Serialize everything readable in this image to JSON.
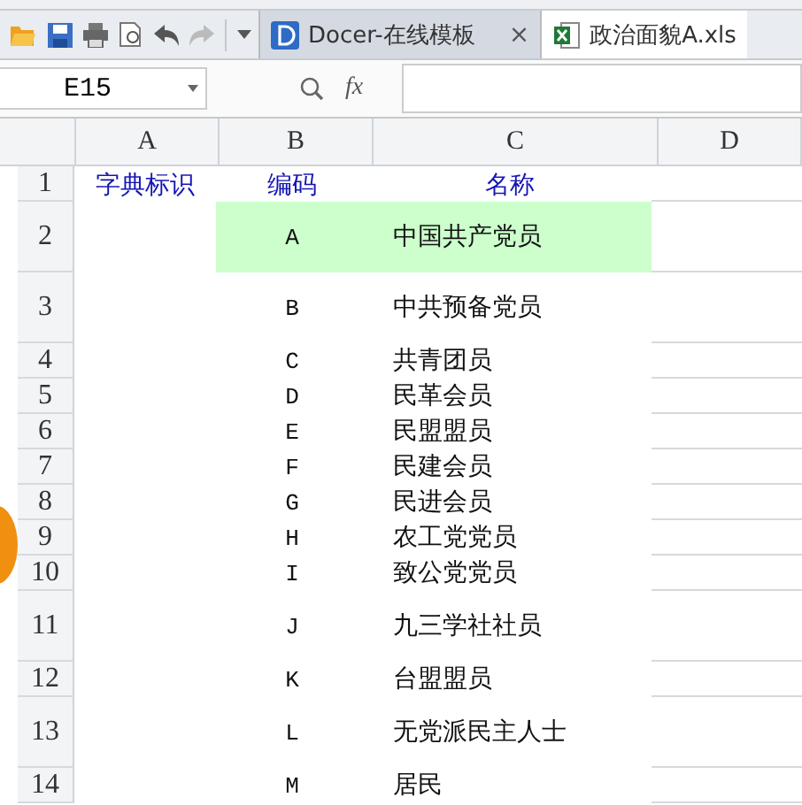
{
  "tabs": [
    {
      "label": "Docer-在线模板",
      "close": "×",
      "selected": false
    },
    {
      "label": "政治面貌A.xls",
      "selected": true
    }
  ],
  "name_box": {
    "value": "E15"
  },
  "formula_bar": {
    "fx": "fx"
  },
  "table": {
    "columns": [
      "A",
      "B",
      "C",
      "D"
    ],
    "rows": [
      {
        "number": "1",
        "cells": [
          "字典标识",
          "编码",
          "名称"
        ],
        "kind": "header",
        "highlighted": false
      },
      {
        "number": "2",
        "cells": [
          "",
          "A",
          "中国共产党员"
        ],
        "kind": "data",
        "highlighted": true
      },
      {
        "number": "3",
        "cells": [
          "",
          "B",
          "中共预备党员"
        ],
        "kind": "data",
        "highlighted": false
      },
      {
        "number": "4",
        "cells": [
          "",
          "C",
          "共青团员"
        ],
        "kind": "data",
        "highlighted": false
      },
      {
        "number": "5",
        "cells": [
          "",
          "D",
          "民革会员"
        ],
        "kind": "data",
        "highlighted": false
      },
      {
        "number": "6",
        "cells": [
          "",
          "E",
          "民盟盟员"
        ],
        "kind": "data",
        "highlighted": false
      },
      {
        "number": "7",
        "cells": [
          "",
          "F",
          "民建会员"
        ],
        "kind": "data",
        "highlighted": false
      },
      {
        "number": "8",
        "cells": [
          "",
          "G",
          "民进会员"
        ],
        "kind": "data",
        "highlighted": false
      },
      {
        "number": "9",
        "cells": [
          "",
          "H",
          "农工党党员"
        ],
        "kind": "data",
        "highlighted": false
      },
      {
        "number": "10",
        "cells": [
          "",
          "I",
          "致公党党员"
        ],
        "kind": "data",
        "highlighted": false
      },
      {
        "number": "11",
        "cells": [
          "",
          "J",
          "九三学社社员"
        ],
        "kind": "data",
        "highlighted": false
      },
      {
        "number": "12",
        "cells": [
          "",
          "K",
          "台盟盟员"
        ],
        "kind": "data",
        "highlighted": false
      },
      {
        "number": "13",
        "cells": [
          "",
          "L",
          "无党派民主人士"
        ],
        "kind": "data",
        "highlighted": false
      },
      {
        "number": "14",
        "cells": [
          "",
          "M",
          "居民"
        ],
        "kind": "data",
        "highlighted": false
      }
    ]
  }
}
